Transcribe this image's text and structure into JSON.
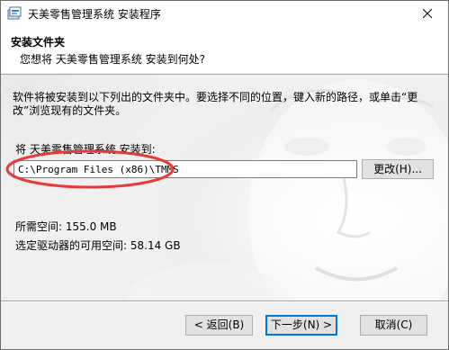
{
  "window": {
    "title": "天美零售管理系统 安装程序"
  },
  "header": {
    "title": "安装文件夹",
    "subtitle": "您想将 天美零售管理系统 安装到何处?"
  },
  "body": {
    "description": "软件将被安装到以下列出的文件夹中。要选择不同的位置，键入新的路径，或单击“更改”浏览现有的文件夹。",
    "install_label": "将 天美零售管理系统 安装到:",
    "install_path": "C:\\Program Files (x86)\\TMMS",
    "browse_label": "更改(H)...",
    "space_required": "所需空间: 155.0 MB",
    "space_available": "选定驱动器的可用空间: 58.14 GB"
  },
  "footer": {
    "back_label": "< 返回(B)",
    "next_label": "下一步(N) >",
    "cancel_label": "取消(C)"
  },
  "colors": {
    "annotation_ellipse": "#e8393a",
    "default_button_border": "#0078d7"
  },
  "icons": {
    "app": "installer-app-icon",
    "close": "close-icon"
  }
}
